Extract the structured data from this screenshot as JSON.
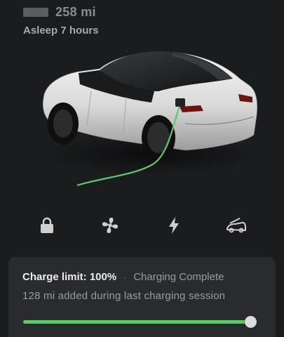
{
  "status": {
    "range": "258 mi",
    "sleep": "Asleep 7 hours"
  },
  "vehicle": {
    "image": "white-sedan-rear-three-quarter",
    "charge_cable_color": "#63c66f"
  },
  "controls": [
    {
      "name": "lock",
      "icon": "lock-icon"
    },
    {
      "name": "climate",
      "icon": "fan-icon"
    },
    {
      "name": "charging",
      "icon": "lightning-bolt-icon"
    },
    {
      "name": "trunk",
      "icon": "trunk-open-icon"
    }
  ],
  "charging": {
    "limit_label": "Charge limit: 100%",
    "separator": "·",
    "status": "Charging Complete",
    "session_text": "128 mi added during last charging session",
    "limit_fraction": 1.0,
    "accent_color": "#63c66f"
  }
}
